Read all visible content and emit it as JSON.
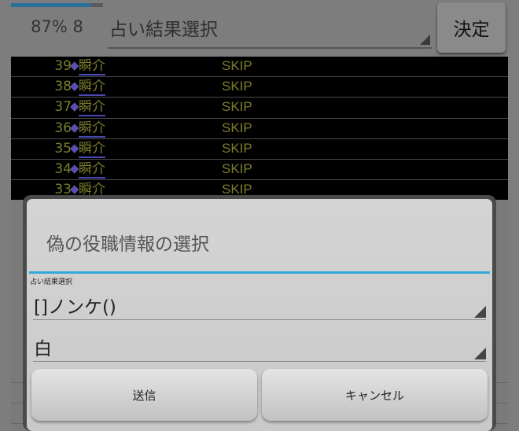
{
  "topbar": {
    "progress_fraction": 0.87,
    "progress_text": "87% 8",
    "selection_label": "占い結果選択",
    "decide_label": "決定"
  },
  "log": {
    "rows": [
      {
        "num": "39",
        "marker": "◆",
        "name": "瞬介",
        "status": "SKIP"
      },
      {
        "num": "38",
        "marker": "◆",
        "name": "瞬介",
        "status": "SKIP"
      },
      {
        "num": "37",
        "marker": "◆",
        "name": "瞬介",
        "status": "SKIP"
      },
      {
        "num": "36",
        "marker": "◆",
        "name": "瞬介",
        "status": "SKIP"
      },
      {
        "num": "35",
        "marker": "◆",
        "name": "瞬介",
        "status": "SKIP"
      },
      {
        "num": "34",
        "marker": "◆",
        "name": "瞬介",
        "status": "SKIP"
      },
      {
        "num": "33",
        "marker": "◆",
        "name": "瞬介",
        "status": "SKIP"
      }
    ]
  },
  "dialog": {
    "title": "偽の役職情報の選択",
    "section_label": "占い結果選択",
    "target_value": "[]ノンケ()",
    "result_value": "白",
    "send_label": "送信",
    "cancel_label": "キャンセル"
  },
  "colors": {
    "accent_divider": "#33a8dc",
    "log_text": "#7d7d2c",
    "log_marker": "#5a4fb0"
  }
}
